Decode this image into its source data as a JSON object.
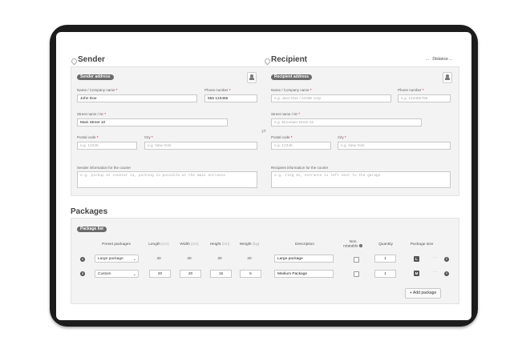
{
  "sender": {
    "title": "Sender",
    "address_pill": "Sender address",
    "name_label": "Name / Company name",
    "name_value": "John Doe",
    "phone_label": "Phone number",
    "phone_value": "555 123456",
    "street_label": "Street name / Nr",
    "street_value": "Main Street 10",
    "postal_label": "Postal code",
    "postal_placeholder": "e.g. 12345",
    "city_label": "City",
    "city_placeholder": "e.g. New York",
    "info_label": "Sender information for the courier",
    "info_placeholder": "e.g. pickup at counter 11, parking is possible at the main entrance"
  },
  "recipient": {
    "title": "Recipient",
    "address_pill": "Recipient address",
    "distance_label": "Distance",
    "distance_value": "...",
    "distance_prefix": "...",
    "name_label": "Name / Company name",
    "name_placeholder": "e.g. Jane Doe / ACME corp",
    "phone_label": "Phone number",
    "phone_placeholder": "e.g. 123456789",
    "street_label": "Street name / Nr",
    "street_placeholder": "e.g. Mountain street 22",
    "postal_label": "Postal code",
    "postal_placeholder": "e.g. 12345",
    "city_label": "City",
    "city_placeholder": "e.g. New York",
    "info_label": "Recipient information for the courier",
    "info_placeholder": "e.g. ring 3x, entrance is left next to the garage"
  },
  "required_mark": "*",
  "packages": {
    "title": "Packages",
    "list_pill": "Package list",
    "columns": {
      "preset": "Preset packages",
      "length": "Length",
      "width": "Width",
      "height": "Height",
      "weight": "Weight",
      "unit_cm": "(cm)",
      "unit_kg": "(kg)",
      "description": "Description",
      "non_rotatable_1": "Non",
      "non_rotatable_2": "rotatable",
      "quantity": "Quantity",
      "size": "Package size"
    },
    "rows": [
      {
        "num": "1",
        "preset": "Large package",
        "length": "40",
        "width": "40",
        "height": "30",
        "weight": "20",
        "description": "Large package",
        "quantity": "1",
        "size": "L"
      },
      {
        "num": "2",
        "preset": "Custom",
        "length": "20",
        "width": "20",
        "height": "15",
        "weight": "5",
        "description": "Medium Package",
        "quantity": "1",
        "size": "M"
      }
    ],
    "add_label": "+ Add package"
  },
  "icons": {
    "pin": "map-pin-icon",
    "contact": "contact-book-icon",
    "swap": "swap-icon",
    "chevron": "chevron-down-icon",
    "remove": "remove-icon",
    "info": "info-icon"
  },
  "colors": {
    "pill_bg": "#6b6b6b",
    "tablet_frame": "#1c1c1c",
    "required": "#cc0000"
  }
}
